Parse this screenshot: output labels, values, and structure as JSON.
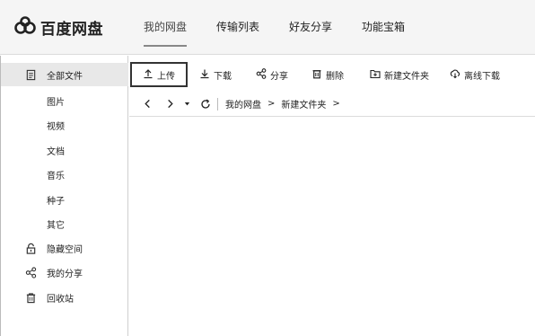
{
  "app": {
    "name": "百度网盘"
  },
  "topnav": [
    {
      "label": "我的网盘",
      "active": true
    },
    {
      "label": "传输列表",
      "active": false
    },
    {
      "label": "好友分享",
      "active": false
    },
    {
      "label": "功能宝箱",
      "active": false
    }
  ],
  "sidebar": {
    "items": [
      {
        "label": "全部文件",
        "icon": "file-icon",
        "active": true
      },
      {
        "label": "图片",
        "icon": "",
        "active": false
      },
      {
        "label": "视频",
        "icon": "",
        "active": false
      },
      {
        "label": "文档",
        "icon": "",
        "active": false
      },
      {
        "label": "音乐",
        "icon": "",
        "active": false
      },
      {
        "label": "种子",
        "icon": "",
        "active": false
      },
      {
        "label": "其它",
        "icon": "",
        "active": false
      },
      {
        "label": "隐藏空间",
        "icon": "lock-icon",
        "active": false
      },
      {
        "label": "我的分享",
        "icon": "share-icon",
        "active": false
      },
      {
        "label": "回收站",
        "icon": "trash-icon",
        "active": false
      }
    ]
  },
  "toolbar": {
    "upload_label": "上传",
    "download_label": "下载",
    "share_label": "分享",
    "delete_label": "删除",
    "new_folder_label": "新建文件夹",
    "offline_download_label": "离线下载"
  },
  "pathbar": {
    "crumbs": [
      "我的网盘",
      "新建文件夹"
    ],
    "arrow": ">"
  },
  "colors": {
    "topbar_bg": "#f5f5f5",
    "active_item_bg": "#e8e8e8",
    "border": "#dcdcdc"
  }
}
